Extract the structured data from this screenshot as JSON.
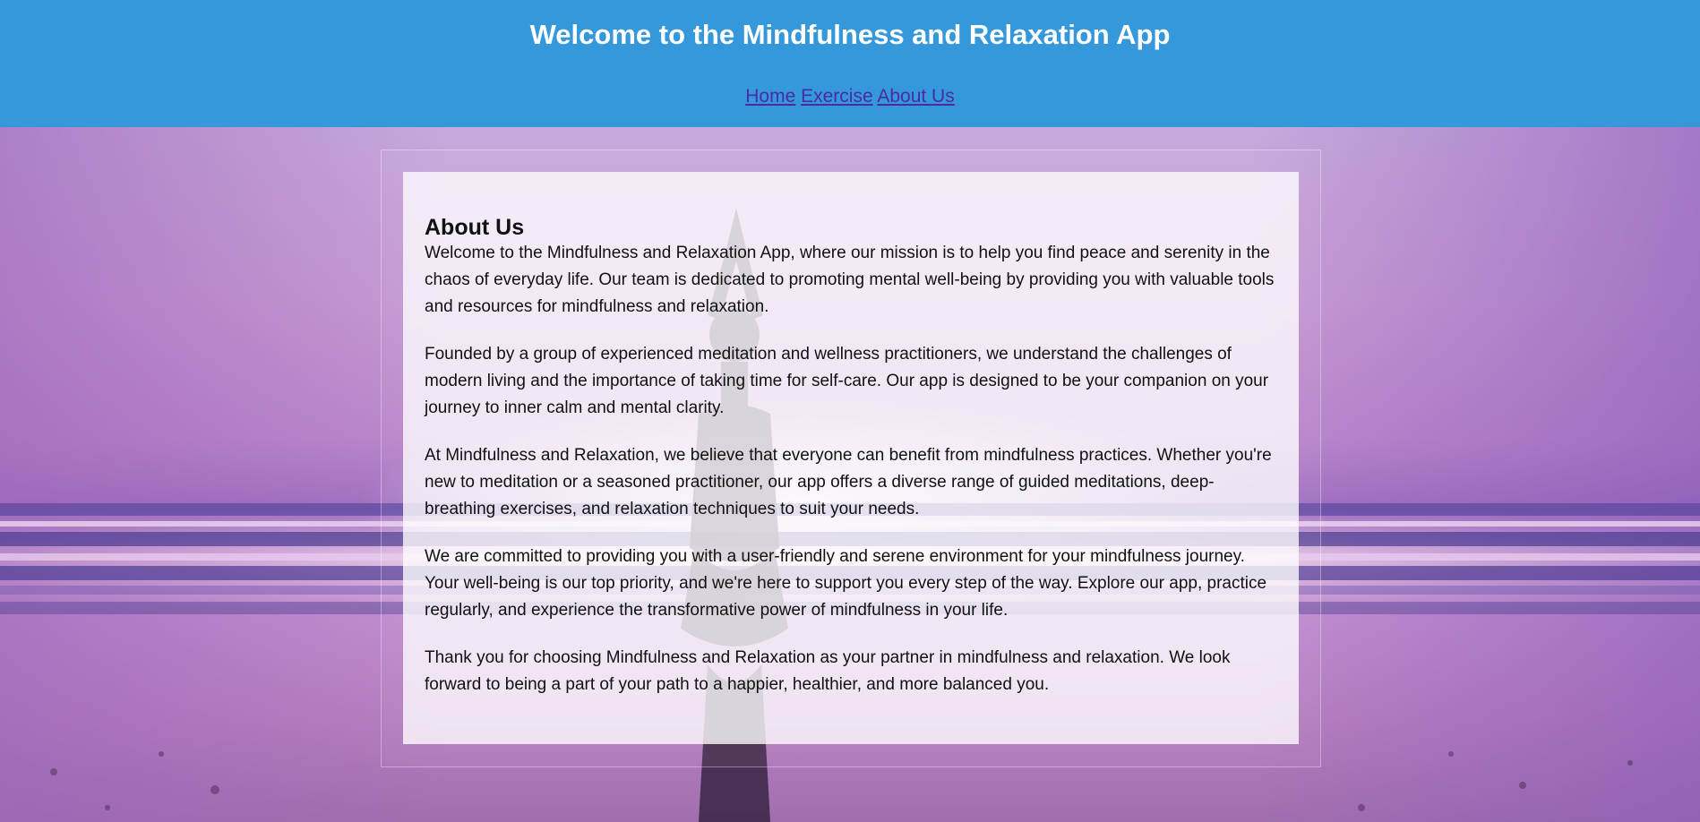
{
  "header": {
    "title": "Welcome to the Mindfulness and Relaxation App",
    "nav": [
      "Home",
      "Exercise",
      "About Us"
    ]
  },
  "about": {
    "heading": "About Us",
    "paragraphs": [
      "Welcome to the Mindfulness and Relaxation App, where our mission is to help you find peace and serenity in the chaos of everyday life. Our team is dedicated to promoting mental well-being by providing you with valuable tools and resources for mindfulness and relaxation.",
      "Founded by a group of experienced meditation and wellness practitioners, we understand the challenges of modern living and the importance of taking time for self-care. Our app is designed to be your companion on your journey to inner calm and mental clarity.",
      "At Mindfulness and Relaxation, we believe that everyone can benefit from mindfulness practices. Whether you're new to meditation or a seasoned practitioner, our app offers a diverse range of guided meditations, deep-breathing exercises, and relaxation techniques to suit your needs.",
      "We are committed to providing you with a user-friendly and serene environment for your mindfulness journey. Your well-being is our top priority, and we're here to support you every step of the way. Explore our app, practice regularly, and experience the transformative power of mindfulness in your life.",
      "Thank you for choosing Mindfulness and Relaxation as your partner in mindfulness and relaxation. We look forward to being a part of your path to a happier, healthier, and more balanced you."
    ]
  },
  "colors": {
    "header_bg": "#3498db",
    "header_text": "#ffffff",
    "nav_link": "#4b2aa6",
    "card_bg": "rgba(255,255,255,0.78)"
  },
  "background": {
    "description_icon": "yoga-sunset-beach-image"
  }
}
